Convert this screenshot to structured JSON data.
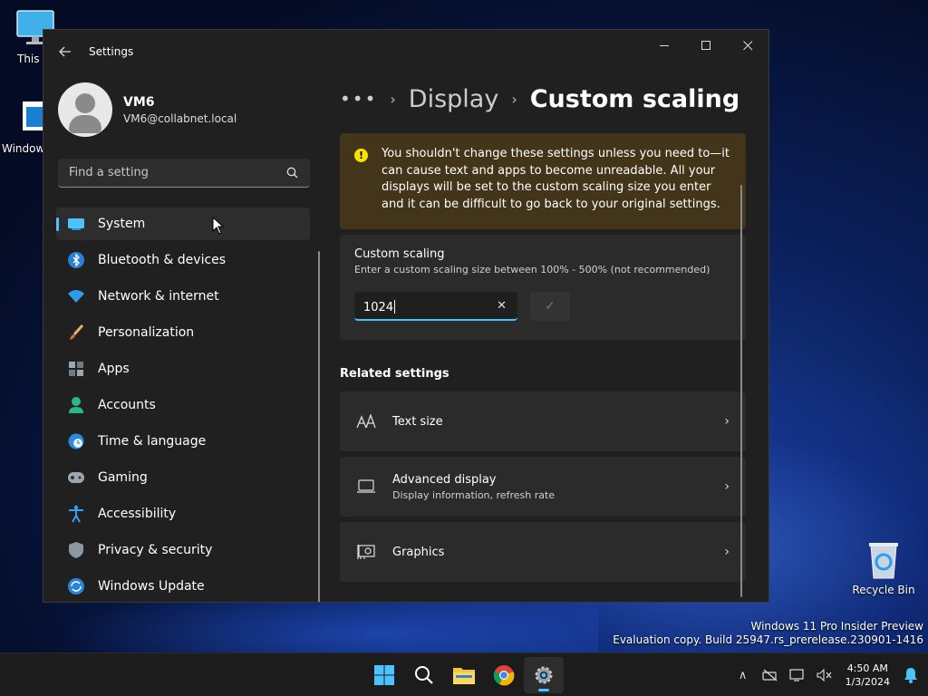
{
  "desktop": {
    "icons": [
      {
        "label": "This PC"
      },
      {
        "label": "Windows"
      },
      {
        "label": "Recycle Bin"
      }
    ],
    "watermark": {
      "line1": "Windows 11 Pro Insider Preview",
      "line2": "Evaluation copy. Build 25947.rs_prerelease.230901-1416"
    }
  },
  "window": {
    "title": "Settings",
    "controls": {
      "minimize": "—",
      "maximize": "☐",
      "close": "✕"
    }
  },
  "profile": {
    "name": "VM6",
    "email": "VM6@collabnet.local"
  },
  "search": {
    "placeholder": "Find a setting"
  },
  "nav": {
    "items": [
      {
        "label": "System",
        "icon": "system-icon",
        "active": true
      },
      {
        "label": "Bluetooth & devices",
        "icon": "bluetooth-icon"
      },
      {
        "label": "Network & internet",
        "icon": "wifi-icon"
      },
      {
        "label": "Personalization",
        "icon": "brush-icon"
      },
      {
        "label": "Apps",
        "icon": "apps-icon"
      },
      {
        "label": "Accounts",
        "icon": "accounts-icon"
      },
      {
        "label": "Time & language",
        "icon": "globe-icon"
      },
      {
        "label": "Gaming",
        "icon": "gamepad-icon"
      },
      {
        "label": "Accessibility",
        "icon": "accessibility-icon"
      },
      {
        "label": "Privacy & security",
        "icon": "shield-icon"
      },
      {
        "label": "Windows Update",
        "icon": "update-icon"
      }
    ]
  },
  "breadcrumb": {
    "more": "•••",
    "sep": "›",
    "parent": "Display",
    "current": "Custom scaling"
  },
  "warning": {
    "icon": "!",
    "text": "You shouldn't change these settings unless you need to—it can cause text and apps to become unreadable. All your displays will be set to the custom scaling size you enter and it can be difficult to go back to your original settings."
  },
  "custom_scaling": {
    "title": "Custom scaling",
    "description": "Enter a custom scaling size between 100% - 500% (not recommended)",
    "value": "1024",
    "clear": "✕",
    "apply": "✓"
  },
  "related": {
    "title": "Related settings",
    "items": [
      {
        "title": "Text size",
        "subtitle": "",
        "icon": "text-size-icon"
      },
      {
        "title": "Advanced display",
        "subtitle": "Display information, refresh rate",
        "icon": "monitor-icon"
      },
      {
        "title": "Graphics",
        "subtitle": "",
        "icon": "graphics-card-icon"
      }
    ],
    "chevron": "›"
  },
  "taskbar": {
    "apps": [
      "start",
      "search",
      "file-explorer",
      "chrome",
      "settings"
    ],
    "tray_chevron": "∧",
    "time": "4:50 AM",
    "date": "1/3/2024"
  },
  "colors": {
    "accent": "#4cc2ff",
    "warning_bg": "#433519",
    "warning_icon": "#fce100",
    "window_bg": "#202020",
    "card_bg": "#2b2b2b"
  }
}
